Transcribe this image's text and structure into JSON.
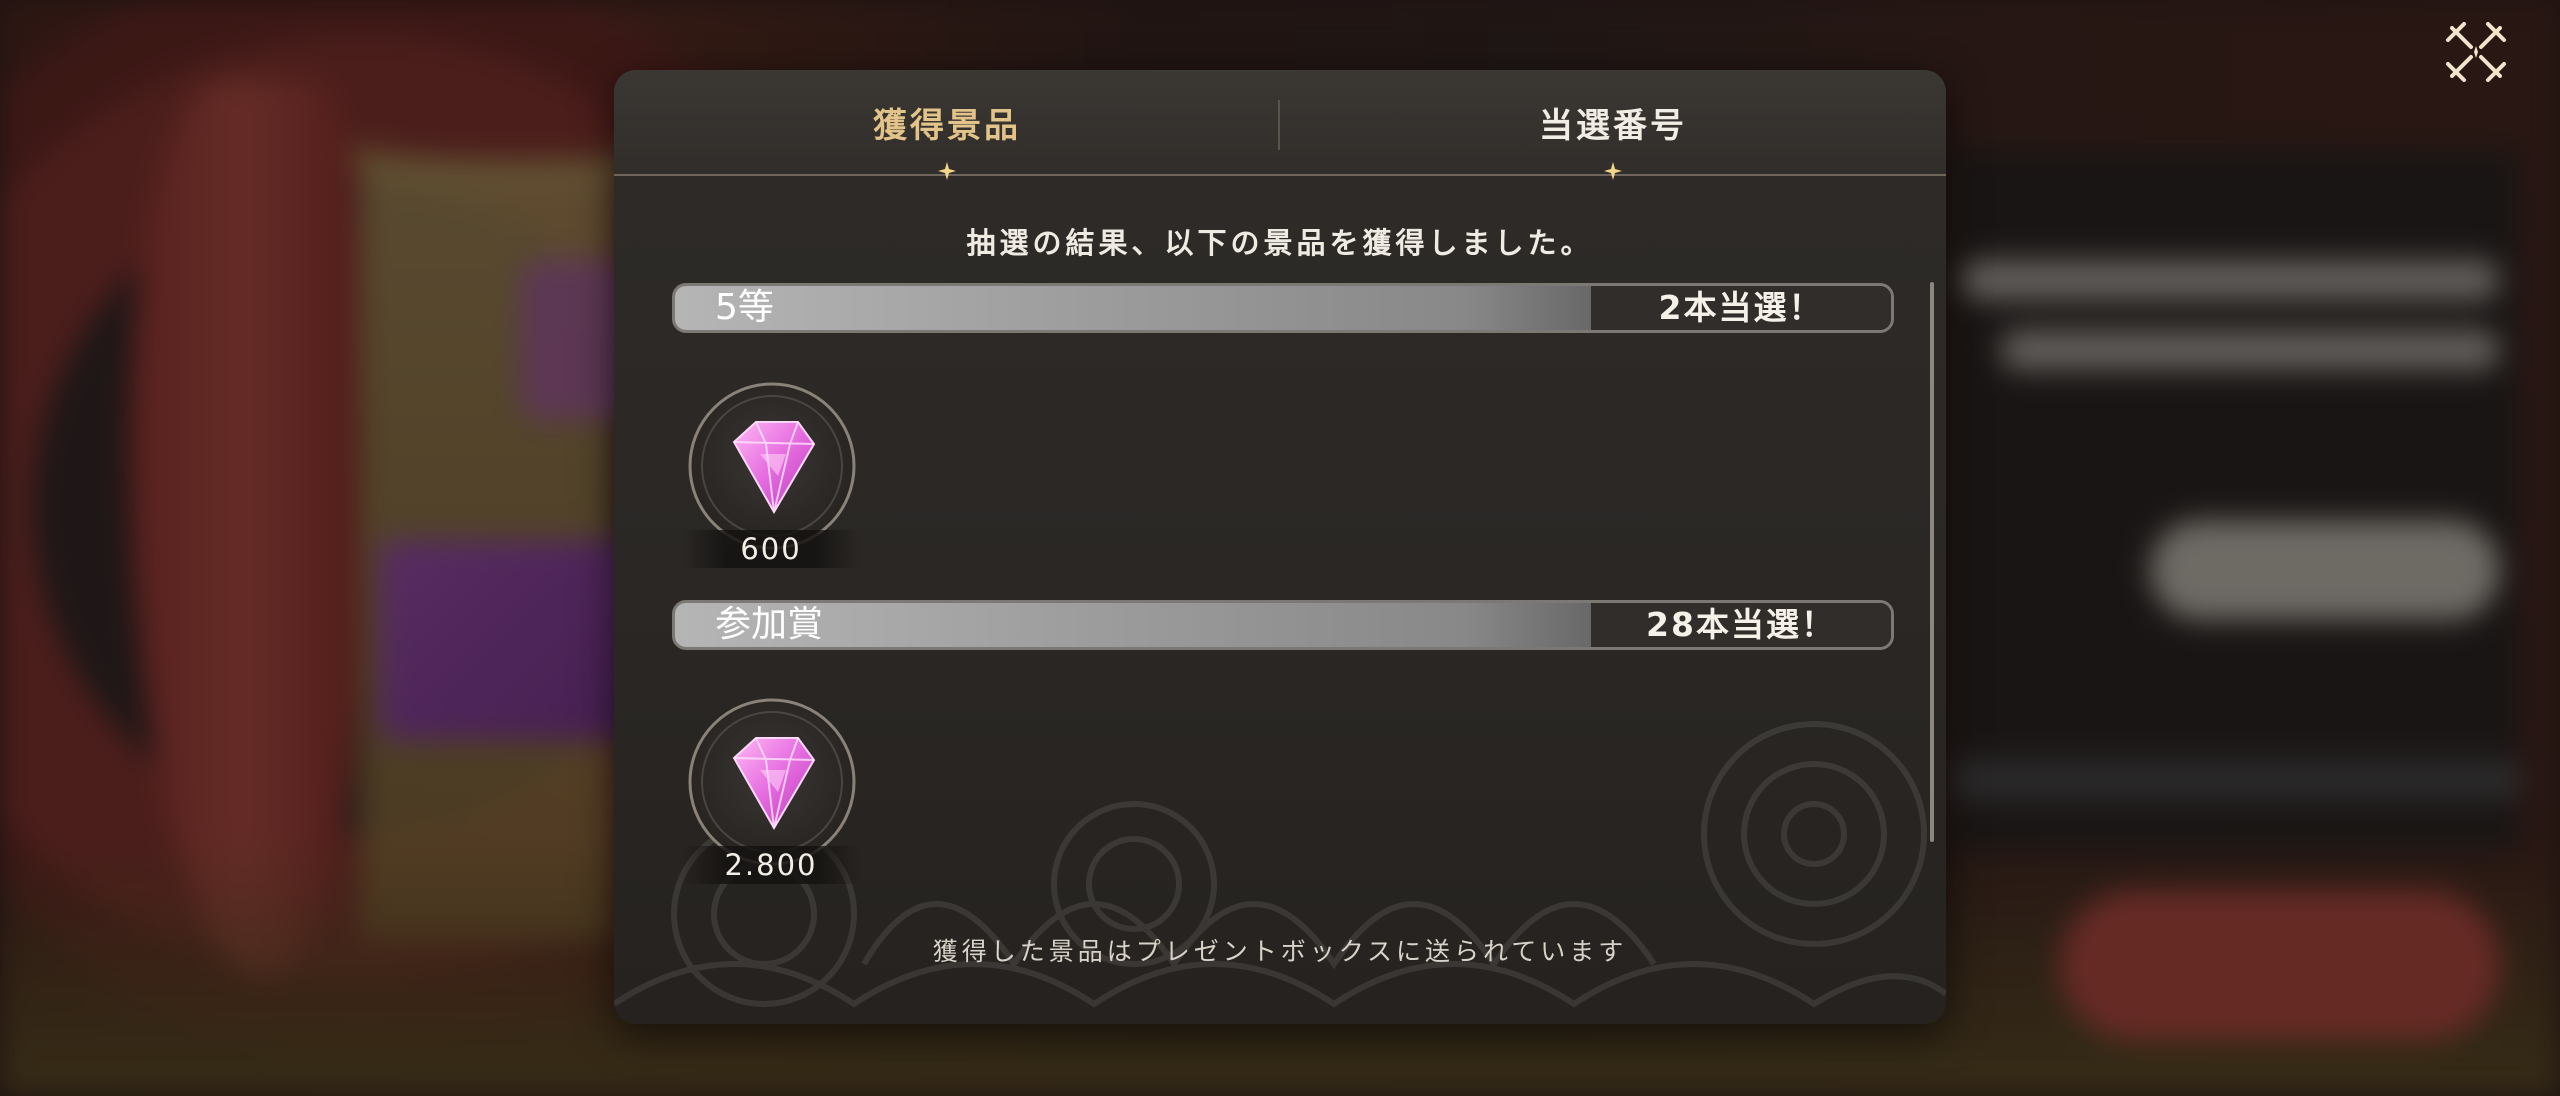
{
  "tabs": [
    {
      "label": "獲得景品",
      "active": true
    },
    {
      "label": "当選番号",
      "active": false
    }
  ],
  "intro_text": "抽選の結果、以下の景品を獲得しました。",
  "prizes": [
    {
      "rank": "5等",
      "result": "2本当選！",
      "item": {
        "icon": "pink-gem-icon",
        "count": "600"
      }
    },
    {
      "rank": "参加賞",
      "result": "28本当選！",
      "item": {
        "icon": "pink-gem-icon",
        "count": "2.800"
      }
    }
  ],
  "footer_note": "獲得した景品はプレゼントボックスに送られています",
  "colors": {
    "active_tab": "#e2c48a",
    "gem": "#e36fe3",
    "panel": "#2c2926"
  }
}
